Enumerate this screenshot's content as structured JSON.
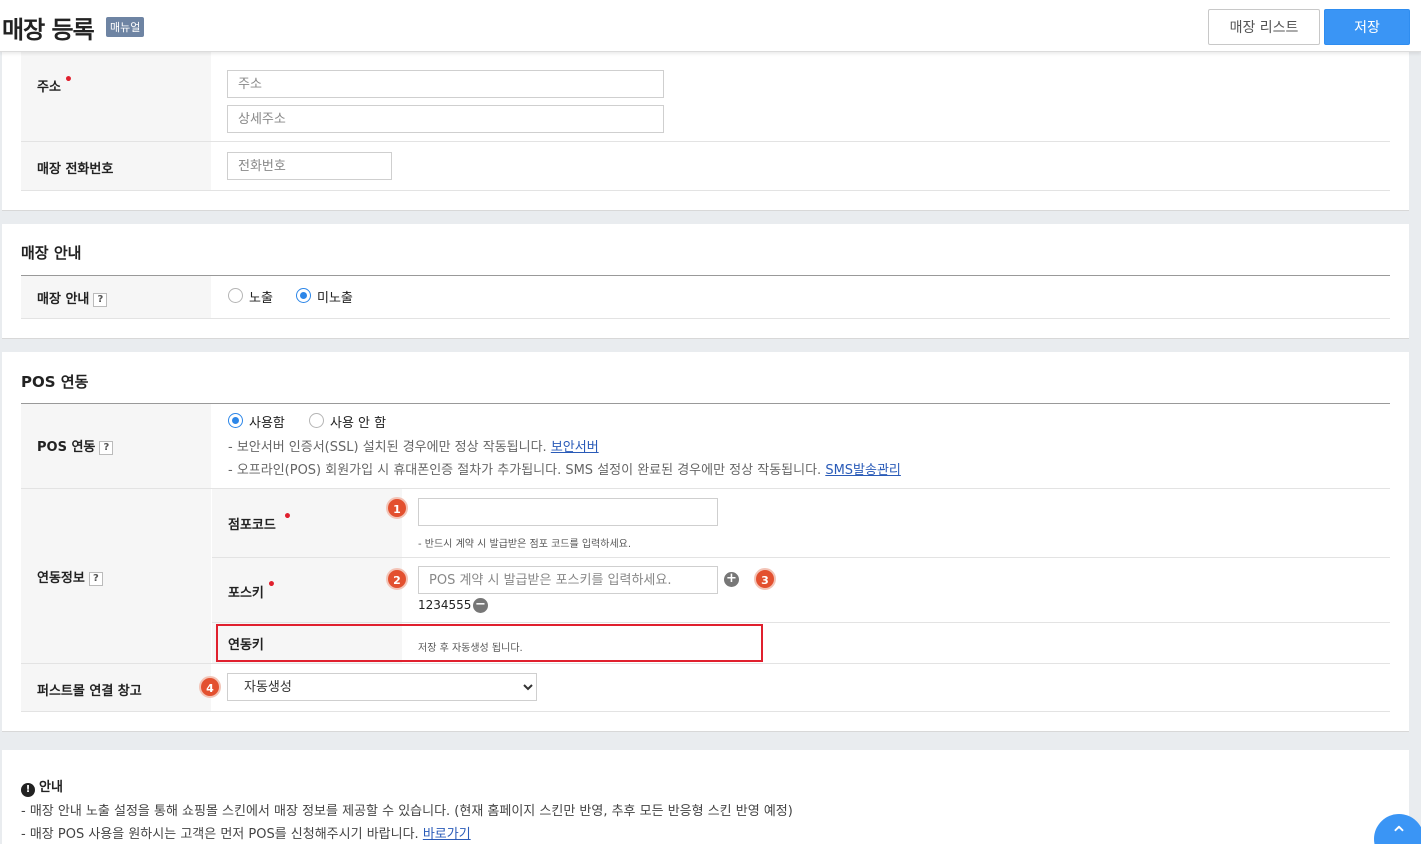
{
  "header": {
    "title": "매장 등록",
    "manual_badge": "매뉴얼",
    "list_button": "매장 리스트",
    "save_button": "저장"
  },
  "basic": {
    "address_label": "주소",
    "address_placeholder": "주소",
    "address_detail_placeholder": "상세주소",
    "phone_label": "매장 전화번호",
    "phone_placeholder": "전화번호"
  },
  "store_guide": {
    "section_title": "매장 안내",
    "row_label": "매장 안내",
    "help": "?",
    "options": [
      "노출",
      "미노출"
    ],
    "selected_index": 1
  },
  "pos": {
    "section_title": "POS 연동",
    "row_label": "POS 연동",
    "help": "?",
    "options": [
      "사용함",
      "사용 안 함"
    ],
    "selected_index": 0,
    "note1_text": "- 보안서버 인증서(SSL) 설치된 경우에만 정상 작동됩니다.",
    "note1_link": "보안서버",
    "note2_text": "- 오프라인(POS) 회원가입 시 휴대폰인증 절차가 추가됩니다. SMS 설정이 완료된 경우에만 정상 작동됩니다.",
    "note2_link": "SMS발송관리",
    "link_info_label": "연동정보",
    "store_code_label": "점포코드",
    "store_code_hint": "- 반드시 계약 시 발급받은 점포 코드를 입력하세요.",
    "pos_key_label": "포스키",
    "pos_key_placeholder": "POS 계약 시 발급받은 포스키를 입력하세요.",
    "pos_key_value": "1234555",
    "link_key_label": "연동키",
    "link_key_text": "저장 후 자동생성 됩니다.",
    "warehouse_label": "퍼스트몰 연결 창고",
    "warehouse_selected": "자동생성",
    "markers": [
      "1",
      "2",
      "3",
      "4"
    ]
  },
  "guide": {
    "title": "안내",
    "line1": "- 매장 안내 노출 설정을 통해 쇼핑몰 스킨에서 매장 정보를 제공할 수 있습니다. (현재 홈페이지 스킨만 반영, 추후 모든 반응형 스킨 반영 예정)",
    "line2_text": "- 매장 POS 사용을 원하시는 고객은 먼저 POS를 신청해주시기 바랍니다.",
    "line2_link": "바로가기"
  },
  "icons": {
    "info": "exclamation-circle-icon",
    "plus": "plus-circle-icon",
    "minus": "minus-circle-icon",
    "scroll_top": "chevron-up-icon"
  },
  "colors": {
    "primary": "#3a95f5",
    "required": "#e0202e",
    "marker": "#e3502f",
    "link": "#2a5bb8"
  }
}
